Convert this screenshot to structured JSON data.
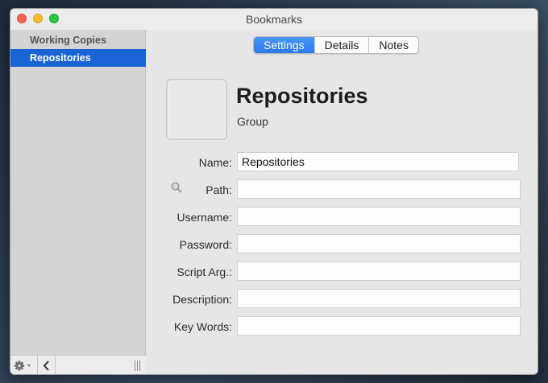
{
  "window": {
    "title": "Bookmarks"
  },
  "sidebar": {
    "items": [
      {
        "label": "Working Copies",
        "selected": false
      },
      {
        "label": "Repositories",
        "selected": true
      }
    ],
    "bottom": {
      "gear_icon": "gear-icon",
      "collapse_icon": "chevron-left-icon",
      "handle_icon": "resize-handle-icon"
    }
  },
  "tabs": [
    {
      "label": "Settings",
      "active": true
    },
    {
      "label": "Details",
      "active": false
    },
    {
      "label": "Notes",
      "active": false
    }
  ],
  "header": {
    "title": "Repositories",
    "subtitle": "Group",
    "icon": "group-placeholder-icon"
  },
  "form": {
    "fields": [
      {
        "label": "Name:",
        "value": "Repositories"
      },
      {
        "label": "Path:",
        "value": "",
        "icon": "search-icon"
      },
      {
        "label": "Username:",
        "value": ""
      },
      {
        "label": "Password:",
        "value": ""
      },
      {
        "label": "Script Arg.:",
        "value": ""
      },
      {
        "label": "Description:",
        "value": ""
      },
      {
        "label": "Key Words:",
        "value": ""
      }
    ]
  },
  "colors": {
    "selection": "#1a64d5",
    "tab_active": "#2a78ee",
    "close": "#fe5f57",
    "minimize": "#febc2e",
    "zoom": "#28c840"
  }
}
